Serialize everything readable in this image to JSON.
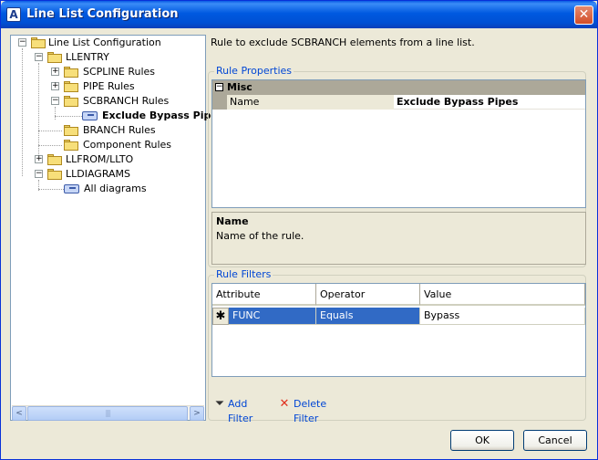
{
  "window": {
    "title": "Line List Configuration",
    "app_icon_glyph": "A",
    "close_glyph": "✕"
  },
  "tree": {
    "items": [
      {
        "label": "Line List Configuration",
        "level": 0,
        "expander": "−",
        "icon": "folder-icon"
      },
      {
        "label": "LLENTRY",
        "level": 1,
        "expander": "−",
        "icon": "folder-icon"
      },
      {
        "label": "SCPLINE Rules",
        "level": 2,
        "expander": "+",
        "icon": "folder-icon"
      },
      {
        "label": "PIPE Rules",
        "level": 2,
        "expander": "+",
        "icon": "folder-icon"
      },
      {
        "label": "SCBRANCH Rules",
        "level": 2,
        "expander": "−",
        "icon": "folder-icon"
      },
      {
        "label": "Exclude Bypass Pipe",
        "level": 3,
        "expander": "",
        "icon": "rule-icon",
        "selected": true
      },
      {
        "label": "BRANCH Rules",
        "level": 2,
        "expander": "",
        "icon": "folder-icon"
      },
      {
        "label": "Component Rules",
        "level": 2,
        "expander": "",
        "icon": "folder-icon"
      },
      {
        "label": "LLFROM/LLTO",
        "level": 1,
        "expander": "+",
        "icon": "folder-icon"
      },
      {
        "label": "LLDIAGRAMS",
        "level": 1,
        "expander": "−",
        "icon": "folder-icon"
      },
      {
        "label": "All diagrams",
        "level": 2,
        "expander": "",
        "icon": "rule-icon"
      }
    ],
    "scroll_left_glyph": "<",
    "scroll_right_glyph": ">",
    "scroll_grip": "|||"
  },
  "description": "Rule to exclude SCBRANCH elements from a line list.",
  "rule_properties": {
    "legend": "Rule Properties",
    "category_expander": "−",
    "category": "Misc",
    "rows": [
      {
        "name": "Name",
        "value": "Exclude Bypass Pipes"
      }
    ],
    "help_title": "Name",
    "help_text": "Name of the rule."
  },
  "rule_filters": {
    "legend": "Rule Filters",
    "columns": [
      "Attribute",
      "Operator",
      "Value"
    ],
    "rows": [
      {
        "marker": "✱",
        "attribute": "FUNC",
        "operator": "Equals",
        "value": "Bypass"
      }
    ]
  },
  "actions": {
    "add_filter": "Add Filter",
    "add_filter_icon_glyph": "⏷",
    "delete_filter": "Delete Filter",
    "delete_filter_icon_glyph": "✕"
  },
  "buttons": {
    "ok": "OK",
    "cancel": "Cancel"
  },
  "colors": {
    "title_bar": "#0058e6",
    "selection": "#316ac5",
    "link": "#0046d5",
    "delete_icon": "#e0301e"
  }
}
